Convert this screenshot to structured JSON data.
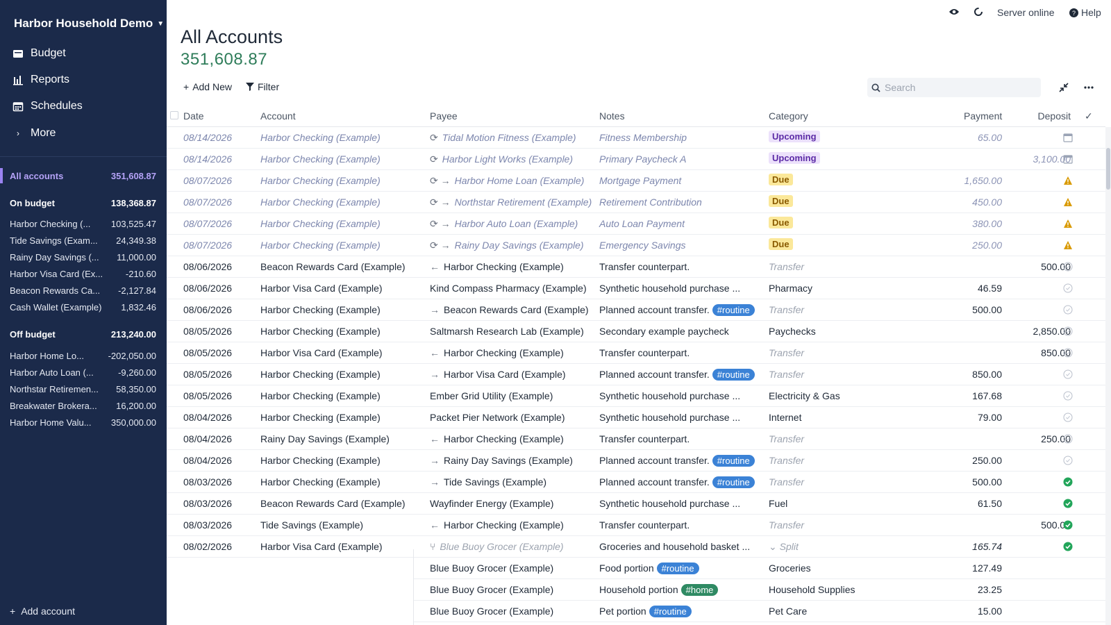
{
  "sidebar": {
    "budget_name": "Harbor Household Demo",
    "nav": [
      {
        "label": "Budget",
        "icon": "wallet-icon"
      },
      {
        "label": "Reports",
        "icon": "bar-chart-icon"
      },
      {
        "label": "Schedules",
        "icon": "calendar-icon"
      },
      {
        "label": "More",
        "icon": "chevron-right-icon"
      }
    ],
    "all_accounts": {
      "name": "All accounts",
      "balance": "351,608.87"
    },
    "on_budget": {
      "name": "On budget",
      "balance": "138,368.87",
      "accounts": [
        {
          "name": "Harbor Checking (...",
          "balance": "103,525.47"
        },
        {
          "name": "Tide Savings (Exam...",
          "balance": "24,349.38"
        },
        {
          "name": "Rainy Day Savings (...",
          "balance": "11,000.00"
        },
        {
          "name": "Harbor Visa Card (Ex...",
          "balance": "-210.60"
        },
        {
          "name": "Beacon Rewards Ca...",
          "balance": "-2,127.84"
        },
        {
          "name": "Cash Wallet (Example)",
          "balance": "1,832.46"
        }
      ]
    },
    "off_budget": {
      "name": "Off budget",
      "balance": "213,240.00",
      "accounts": [
        {
          "name": "Harbor Home Lo...",
          "balance": "-202,050.00"
        },
        {
          "name": "Harbor Auto Loan (...",
          "balance": "-9,260.00"
        },
        {
          "name": "Northstar Retiremen...",
          "balance": "58,350.00"
        },
        {
          "name": "Breakwater Brokera...",
          "balance": "16,200.00"
        },
        {
          "name": "Harbor Home Valu...",
          "balance": "350,000.00"
        }
      ]
    },
    "add_account": "Add account"
  },
  "topbar": {
    "server_status": "Server online",
    "help": "Help"
  },
  "header": {
    "title": "All Accounts",
    "total": "351,608.87"
  },
  "toolbar": {
    "add_new": "Add New",
    "filter": "Filter",
    "search_placeholder": "Search"
  },
  "columns": {
    "date": "Date",
    "account": "Account",
    "payee": "Payee",
    "notes": "Notes",
    "category": "Category",
    "payment": "Payment",
    "deposit": "Deposit",
    "cleared": "✓"
  },
  "rows": [
    {
      "date": "08/14/2026",
      "account": "Harbor Checking (Example)",
      "payee_icon": "sync-icon",
      "payee": "Tidal Motion Fitness (Example)",
      "notes": "Fitness Membership",
      "category": "Upcoming",
      "cat_style": "up",
      "payment": "65.00",
      "deposit": "",
      "status": "calendar",
      "pending": true
    },
    {
      "date": "08/14/2026",
      "account": "Harbor Checking (Example)",
      "payee_icon": "sync-icon",
      "payee": "Harbor Light Works (Example)",
      "notes": "Primary Paycheck A",
      "category": "Upcoming",
      "cat_style": "up",
      "payment": "",
      "deposit": "3,100.00",
      "status": "calendar",
      "pending": true
    },
    {
      "date": "08/07/2026",
      "account": "Harbor Checking (Example)",
      "payee_icon": "sync-arrow-icon",
      "payee": "Harbor Home Loan (Example)",
      "notes": "Mortgage Payment",
      "category": "Due",
      "cat_style": "due",
      "payment": "1,650.00",
      "deposit": "",
      "status": "warning",
      "pending": true
    },
    {
      "date": "08/07/2026",
      "account": "Harbor Checking (Example)",
      "payee_icon": "sync-arrow-icon",
      "payee": "Northstar Retirement (Example)",
      "notes": "Retirement Contribution",
      "category": "Due",
      "cat_style": "due",
      "payment": "450.00",
      "deposit": "",
      "status": "warning",
      "pending": true
    },
    {
      "date": "08/07/2026",
      "account": "Harbor Checking (Example)",
      "payee_icon": "sync-arrow-icon",
      "payee": "Harbor Auto Loan (Example)",
      "notes": "Auto Loan Payment",
      "category": "Due",
      "cat_style": "due",
      "payment": "380.00",
      "deposit": "",
      "status": "warning",
      "pending": true
    },
    {
      "date": "08/07/2026",
      "account": "Harbor Checking (Example)",
      "payee_icon": "sync-arrow-icon",
      "payee": "Rainy Day Savings (Example)",
      "notes": "Emergency Savings",
      "category": "Due",
      "cat_style": "due",
      "payment": "250.00",
      "deposit": "",
      "status": "warning",
      "pending": true
    },
    {
      "date": "08/06/2026",
      "account": "Beacon Rewards Card (Example)",
      "payee_icon": "arrow-left-icon",
      "payee": "Harbor Checking (Example)",
      "notes": "Transfer counterpart.",
      "category": "Transfer",
      "cat_style": "muted",
      "payment": "",
      "deposit": "500.00",
      "status": "circle"
    },
    {
      "date": "08/06/2026",
      "account": "Harbor Visa Card (Example)",
      "payee_icon": "",
      "payee": "Kind Compass Pharmacy (Example)",
      "notes": "Synthetic household purchase ...",
      "category": "Pharmacy",
      "cat_style": "",
      "payment": "46.59",
      "deposit": "",
      "status": "circle"
    },
    {
      "date": "08/06/2026",
      "account": "Harbor Checking (Example)",
      "payee_icon": "arrow-right-icon",
      "payee": "Beacon Rewards Card (Example)",
      "notes": "Planned account transfer.",
      "tag": "#routine",
      "category": "Transfer",
      "cat_style": "muted",
      "payment": "500.00",
      "deposit": "",
      "status": "circle"
    },
    {
      "date": "08/05/2026",
      "account": "Harbor Checking (Example)",
      "payee_icon": "",
      "payee": "Saltmarsh Research Lab (Example)",
      "notes": "Secondary example paycheck",
      "category": "Paychecks",
      "cat_style": "",
      "payment": "",
      "deposit": "2,850.00",
      "status": "circle"
    },
    {
      "date": "08/05/2026",
      "account": "Harbor Visa Card (Example)",
      "payee_icon": "arrow-left-icon",
      "payee": "Harbor Checking (Example)",
      "notes": "Transfer counterpart.",
      "category": "Transfer",
      "cat_style": "muted",
      "payment": "",
      "deposit": "850.00",
      "status": "circle"
    },
    {
      "date": "08/05/2026",
      "account": "Harbor Checking (Example)",
      "payee_icon": "arrow-right-icon",
      "payee": "Harbor Visa Card (Example)",
      "notes": "Planned account transfer.",
      "tag": "#routine",
      "category": "Transfer",
      "cat_style": "muted",
      "payment": "850.00",
      "deposit": "",
      "status": "circle"
    },
    {
      "date": "08/05/2026",
      "account": "Harbor Checking (Example)",
      "payee_icon": "",
      "payee": "Ember Grid Utility (Example)",
      "notes": "Synthetic household purchase ...",
      "category": "Electricity & Gas",
      "cat_style": "",
      "payment": "167.68",
      "deposit": "",
      "status": "circle"
    },
    {
      "date": "08/04/2026",
      "account": "Harbor Checking (Example)",
      "payee_icon": "",
      "payee": "Packet Pier Network (Example)",
      "notes": "Synthetic household purchase ...",
      "category": "Internet",
      "cat_style": "",
      "payment": "79.00",
      "deposit": "",
      "status": "circle"
    },
    {
      "date": "08/04/2026",
      "account": "Rainy Day Savings (Example)",
      "payee_icon": "arrow-left-icon",
      "payee": "Harbor Checking (Example)",
      "notes": "Transfer counterpart.",
      "category": "Transfer",
      "cat_style": "muted",
      "payment": "",
      "deposit": "250.00",
      "status": "circle"
    },
    {
      "date": "08/04/2026",
      "account": "Harbor Checking (Example)",
      "payee_icon": "arrow-right-icon",
      "payee": "Rainy Day Savings (Example)",
      "notes": "Planned account transfer.",
      "tag": "#routine",
      "category": "Transfer",
      "cat_style": "muted",
      "payment": "250.00",
      "deposit": "",
      "status": "circle"
    },
    {
      "date": "08/03/2026",
      "account": "Harbor Checking (Example)",
      "payee_icon": "arrow-right-icon",
      "payee": "Tide Savings (Example)",
      "notes": "Planned account transfer.",
      "tag": "#routine",
      "category": "Transfer",
      "cat_style": "muted",
      "payment": "500.00",
      "deposit": "",
      "status": "check"
    },
    {
      "date": "08/03/2026",
      "account": "Beacon Rewards Card (Example)",
      "payee_icon": "",
      "payee": "Wayfinder Energy (Example)",
      "notes": "Synthetic household purchase ...",
      "category": "Fuel",
      "cat_style": "",
      "payment": "61.50",
      "deposit": "",
      "status": "check"
    },
    {
      "date": "08/03/2026",
      "account": "Tide Savings (Example)",
      "payee_icon": "arrow-left-icon",
      "payee": "Harbor Checking (Example)",
      "notes": "Transfer counterpart.",
      "category": "Transfer",
      "cat_style": "muted",
      "payment": "",
      "deposit": "500.00",
      "status": "check"
    },
    {
      "date": "08/02/2026",
      "account": "Harbor Visa Card (Example)",
      "payee_icon": "split-icon",
      "payee": "Blue Buoy Grocer (Example)",
      "payee_muted": true,
      "notes": "Groceries and household basket ...",
      "category": "Split",
      "cat_style": "split",
      "payment": "165.74",
      "deposit": "",
      "status": "check",
      "italic_payment": true
    }
  ],
  "split_rows": [
    {
      "payee": "Blue Buoy Grocer (Example)",
      "notes": "Food portion",
      "tag": "#routine",
      "tag_style": "",
      "category": "Groceries",
      "payment": "127.49"
    },
    {
      "payee": "Blue Buoy Grocer (Example)",
      "notes": "Household portion",
      "tag": "#home",
      "tag_style": "home",
      "category": "Household Supplies",
      "payment": "23.25"
    },
    {
      "payee": "Blue Buoy Grocer (Example)",
      "notes": "Pet portion",
      "tag": "#routine",
      "tag_style": "",
      "category": "Pet Care",
      "payment": "15.00"
    }
  ],
  "colors": {
    "sidebar_bg": "#1b2a4a",
    "accent": "#9a83f2",
    "total_green": "#2f7d5a",
    "tag_blue": "#3b82d6",
    "tag_green": "#2f8a63",
    "check_green": "#22a55a",
    "warning": "#d99a00"
  }
}
